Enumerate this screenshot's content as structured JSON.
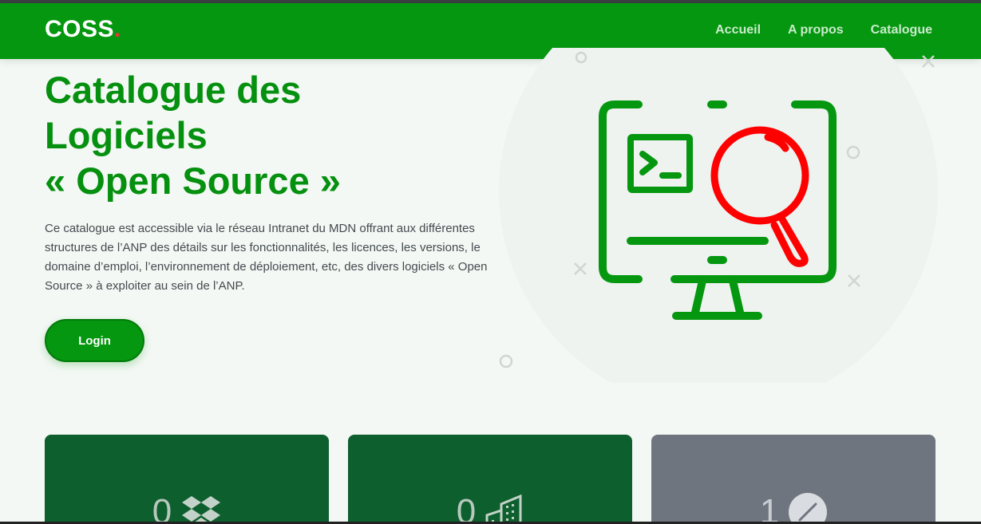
{
  "header": {
    "logo_text": "COSS",
    "logo_dot": ".",
    "nav": [
      "Accueil",
      "A propos",
      "Catalogue"
    ]
  },
  "hero": {
    "title_lines": [
      "Catalogue des",
      "Logiciels",
      "« Open Source »"
    ],
    "description": "Ce catalogue est accessible via le réseau Intranet du MDN offrant aux différentes structures de l’ANP des détails sur les fonctionnalités, les licences, les versions, le domaine d’emploi, l’environnement de déploiement, etc, des divers logiciels « Open Source » à exploiter au sein de l’ANP.",
    "login_label": "Login"
  },
  "stats": [
    {
      "value": "0",
      "icon": "dropbox-icon"
    },
    {
      "value": "0",
      "icon": "building-icon"
    },
    {
      "value": "1",
      "icon": "circle-slash-icon"
    }
  ],
  "colors": {
    "primary": "#04970f",
    "title": "#05900f",
    "magnifier": "#ff0000",
    "card_dark": "#0e5f2e",
    "card_grey": "#6f757e"
  }
}
